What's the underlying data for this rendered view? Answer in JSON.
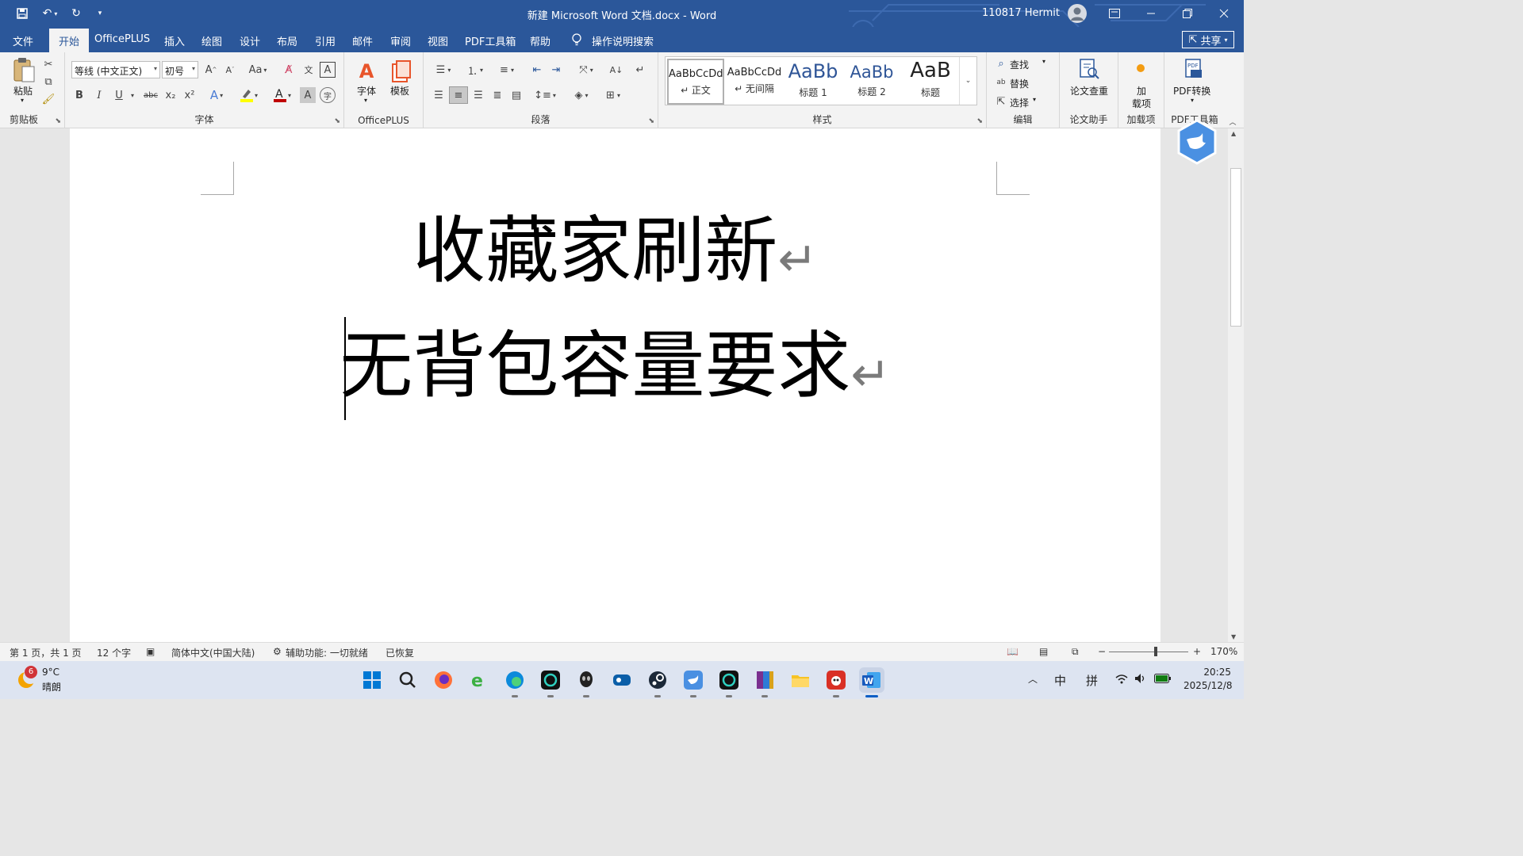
{
  "titlebar": {
    "document_title": "新建 Microsoft Word 文档.docx - Word",
    "user_name": "110817 Hermit",
    "qat": [
      "save-icon",
      "undo-icon",
      "redo-icon",
      "customize-qat-icon"
    ]
  },
  "tabs": {
    "file": "文件",
    "items": [
      "开始",
      "OfficePLUS",
      "插入",
      "绘图",
      "设计",
      "布局",
      "引用",
      "邮件",
      "审阅",
      "视图",
      "PDF工具箱",
      "帮助"
    ],
    "active": "开始",
    "tell_me": "操作说明搜索",
    "share": "共享"
  },
  "ribbon": {
    "clipboard": {
      "paste": "粘贴",
      "label": "剪贴板"
    },
    "font": {
      "font_name": "等线 (中文正文)",
      "font_size": "初号",
      "label": "字体",
      "bold": "B",
      "italic": "I",
      "underline": "U",
      "strike": "abc",
      "subscript": "x₂",
      "superscript": "x²",
      "font_color": "#c00000",
      "highlight_color": "#ffff00"
    },
    "officeplus": {
      "font_btn": "字体",
      "template_btn": "模板",
      "label": "OfficePLUS"
    },
    "paragraph": {
      "label": "段落"
    },
    "styles": {
      "label": "样式",
      "items": [
        {
          "sample": "AaBbCcDd",
          "name": "↵ 正文"
        },
        {
          "sample": "AaBbCcDd",
          "name": "↵ 无间隔"
        },
        {
          "sample": "AaBb",
          "name": "标题 1"
        },
        {
          "sample": "AaBb",
          "name": "标题 2"
        },
        {
          "sample": "AaB",
          "name": "标题"
        }
      ]
    },
    "editing": {
      "find": "查找",
      "replace": "替换",
      "select": "选择",
      "label": "编辑"
    },
    "paper": {
      "btn": "论文查重",
      "label": "论文助手"
    },
    "addins": {
      "btn_line1": "加",
      "btn_line2": "载项",
      "label": "加载项"
    },
    "pdf": {
      "btn": "PDF转换",
      "label": "PDF工具箱"
    }
  },
  "document": {
    "lines": [
      "收藏家刷新",
      "无背包容量要求"
    ],
    "paragraph_mark": "↵"
  },
  "statusbar": {
    "page": "第 1 页，共 1 页",
    "words": "12 个字",
    "language": "简体中文(中国大陆)",
    "accessibility": "辅助功能: 一切就绪",
    "recovered": "已恢复",
    "zoom": "170%",
    "zoom_minus": "−",
    "zoom_plus": "+"
  },
  "taskbar": {
    "weather_badge": "6",
    "temp": "9°C",
    "weather": "晴朗",
    "ime_lang": "中",
    "ime_mode": "拼",
    "time": "20:25",
    "date": "2025/12/8"
  }
}
